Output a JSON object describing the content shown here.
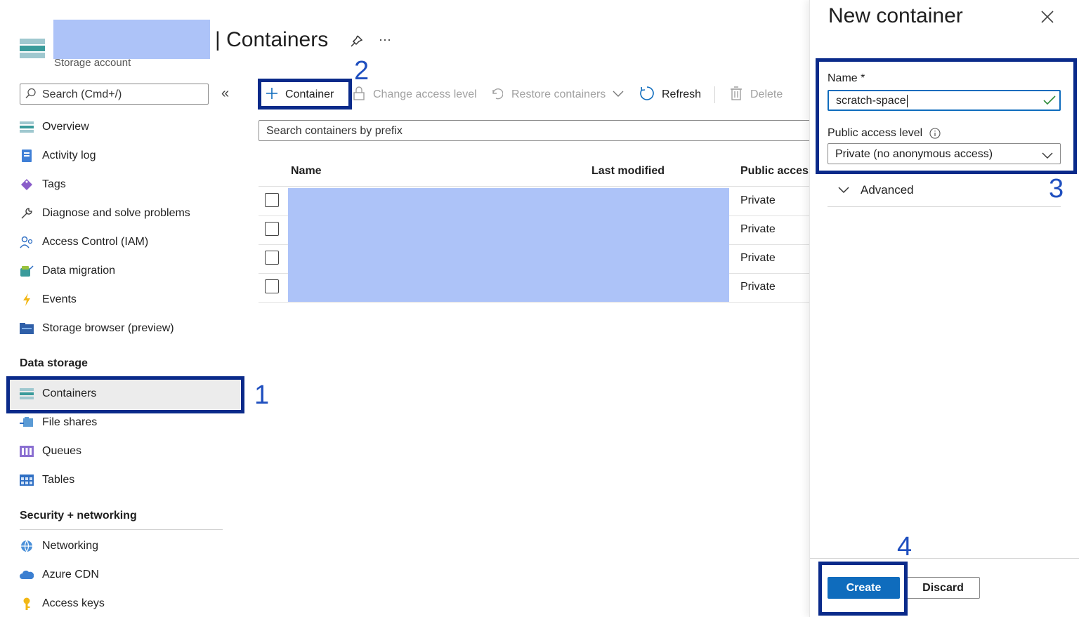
{
  "header": {
    "subtitle": "Storage account",
    "title": "| Containers",
    "pin_icon": "pin-icon",
    "more": "···"
  },
  "sidebar": {
    "search_placeholder": "Search (Cmd+/)",
    "collapse": "«",
    "items": [
      {
        "label": "Overview",
        "icon": "overview-icon"
      },
      {
        "label": "Activity log",
        "icon": "activity-log-icon"
      },
      {
        "label": "Tags",
        "icon": "tag-icon"
      },
      {
        "label": "Diagnose and solve problems",
        "icon": "wrench-icon"
      },
      {
        "label": "Access Control (IAM)",
        "icon": "people-icon"
      },
      {
        "label": "Data migration",
        "icon": "migration-icon"
      },
      {
        "label": "Events",
        "icon": "lightning-icon"
      },
      {
        "label": "Storage browser (preview)",
        "icon": "folder-icon"
      }
    ],
    "section_data_storage": "Data storage",
    "data_storage_items": [
      {
        "label": "Containers",
        "icon": "containers-icon",
        "selected": true
      },
      {
        "label": "File shares",
        "icon": "file-shares-icon"
      },
      {
        "label": "Queues",
        "icon": "queues-icon"
      },
      {
        "label": "Tables",
        "icon": "tables-icon"
      }
    ],
    "section_security": "Security + networking",
    "security_items": [
      {
        "label": "Networking",
        "icon": "globe-icon"
      },
      {
        "label": "Azure CDN",
        "icon": "cloud-icon"
      },
      {
        "label": "Access keys",
        "icon": "key-icon"
      }
    ]
  },
  "toolbar": {
    "add_container": "Container",
    "change_access": "Change access level",
    "restore": "Restore containers",
    "refresh": "Refresh",
    "delete": "Delete"
  },
  "filter": {
    "placeholder": "Search containers by prefix"
  },
  "table": {
    "columns": [
      "Name",
      "Last modified",
      "Public access"
    ],
    "rows": [
      {
        "access": "Private"
      },
      {
        "access": "Private"
      },
      {
        "access": "Private"
      },
      {
        "access": "Private"
      }
    ]
  },
  "panel": {
    "title": "New container",
    "name_label": "Name",
    "required": "*",
    "name_value": "scratch-space",
    "access_label": "Public access level",
    "access_value": "Private (no anonymous access)",
    "advanced": "Advanced",
    "create": "Create",
    "discard": "Discard"
  },
  "annotations": [
    "1",
    "2",
    "3",
    "4"
  ],
  "colors": {
    "accent": "#0f6cbd",
    "highlight": "#0a2a8a",
    "step_number": "#1f4fbf",
    "redaction": "#adc3f8"
  }
}
